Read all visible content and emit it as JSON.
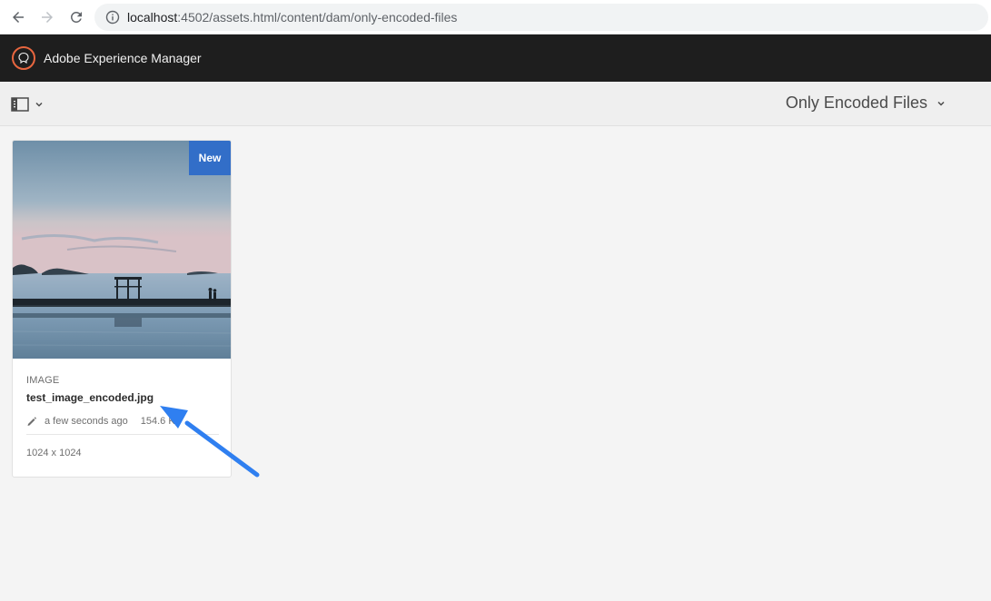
{
  "browser": {
    "url_host": "localhost",
    "url_port_path": ":4502/assets.html/content/dam/only-encoded-files"
  },
  "app": {
    "title": "Adobe Experience Manager"
  },
  "toolbar": {
    "view_title": "Only Encoded Files"
  },
  "card": {
    "badge": "New",
    "type": "IMAGE",
    "name": "test_image_encoded.jpg",
    "modified": "a few seconds ago",
    "size": "154.6 KB",
    "dimensions": "1024 x 1024"
  },
  "colors": {
    "header_bg": "#1e1e1e",
    "badge_bg": "#326ec8",
    "logo_accent": "#e8663f",
    "annotation_arrow": "#2f7ff0"
  },
  "icons": [
    "back-arrow-icon",
    "forward-arrow-icon",
    "reload-icon",
    "info-icon",
    "aem-logo-icon",
    "rail-toggle-icon",
    "chevron-down-icon",
    "edit-pencil-icon"
  ]
}
